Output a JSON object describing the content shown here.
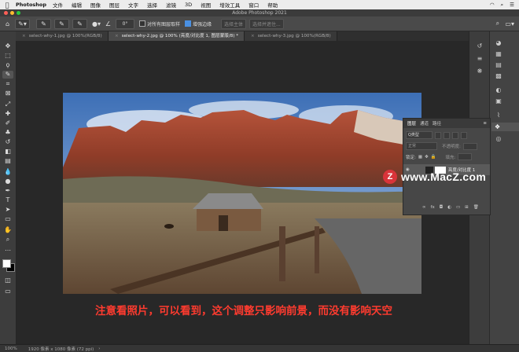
{
  "menubar": {
    "app": "Photoshop",
    "items": [
      "文件",
      "编辑",
      "图像",
      "图层",
      "文字",
      "选择",
      "滤镜",
      "3D",
      "视图",
      "增效工具",
      "窗口",
      "帮助"
    ]
  },
  "window": {
    "title": "Adobe Photoshop 2021"
  },
  "options": {
    "size_value": "0°",
    "sample_all_layers": "对所有图层取样",
    "enhance_edge": "增强边缘",
    "select_subject": "选择主体",
    "select_and_mask": "选择并遮住..."
  },
  "tabs": [
    {
      "label": "select-why-1.jpg @ 100%(RGB/8)"
    },
    {
      "label": "select-why-2.jpg @ 100% (亮度/对比度 1, 图层蒙版/8) *"
    },
    {
      "label": "select-why-3.jpg @ 100%(RGB/8)"
    }
  ],
  "layers_panel": {
    "tabs": [
      "图层",
      "通道",
      "路径"
    ],
    "filter_label": "Q类型",
    "blend_mode": "正常",
    "opacity_label": "不透明度:",
    "lock_label": "锁定:",
    "fill_label": "填充:",
    "layer_name": "亮度/对比度 1"
  },
  "watermark": {
    "logo": "Z",
    "text": "www.MacZ.com"
  },
  "subtitle": "注意看照片，可以看到，这个调整只影响前景，而没有影响天空",
  "status": {
    "zoom": "100%",
    "doc_info": "1920 像素 x 1080 像素 (72 ppi)"
  },
  "colors": {
    "accent": "#4a90e2",
    "subtitle": "#ff3b2f",
    "watermark": "#d9343a"
  }
}
